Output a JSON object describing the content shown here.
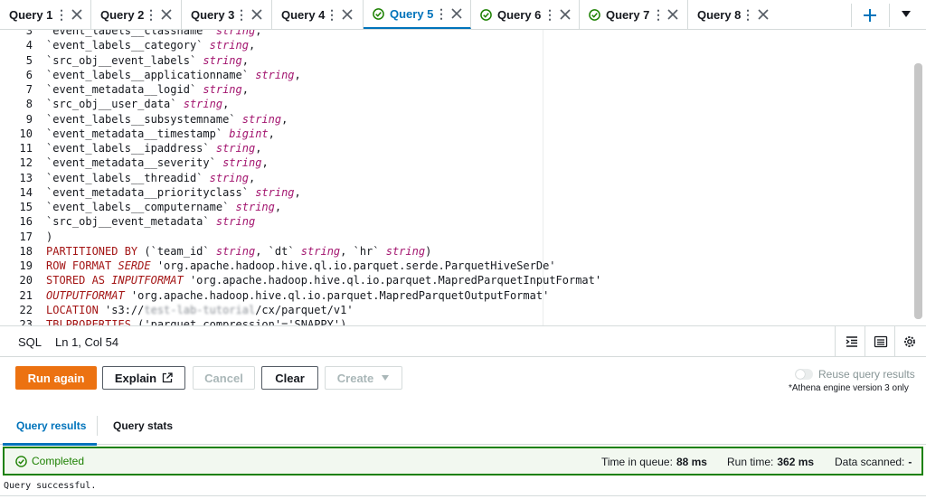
{
  "tabs": [
    {
      "label": "Query 1",
      "completed": false,
      "active": false
    },
    {
      "label": "Query 2",
      "completed": false,
      "active": false
    },
    {
      "label": "Query 3",
      "completed": false,
      "active": false
    },
    {
      "label": "Query 4",
      "completed": false,
      "active": false
    },
    {
      "label": "Query 5",
      "completed": true,
      "active": true
    },
    {
      "label": "Query 6",
      "completed": true,
      "active": false
    },
    {
      "label": "Query 7",
      "completed": true,
      "active": false
    },
    {
      "label": "Query 8",
      "completed": false,
      "active": false
    }
  ],
  "editor": {
    "lines": [
      {
        "n": "3",
        "parts": [
          [
            "plain",
            "`event_labels__classname` "
          ],
          [
            "typ",
            "string"
          ],
          [
            "plain",
            ","
          ]
        ]
      },
      {
        "n": "4",
        "parts": [
          [
            "plain",
            "`event_labels__category` "
          ],
          [
            "typ",
            "string"
          ],
          [
            "plain",
            ","
          ]
        ]
      },
      {
        "n": "5",
        "parts": [
          [
            "plain",
            "`src_obj__event_labels` "
          ],
          [
            "typ",
            "string"
          ],
          [
            "plain",
            ","
          ]
        ]
      },
      {
        "n": "6",
        "parts": [
          [
            "plain",
            "`event_labels__applicationname` "
          ],
          [
            "typ",
            "string"
          ],
          [
            "plain",
            ","
          ]
        ]
      },
      {
        "n": "7",
        "parts": [
          [
            "plain",
            "`event_metadata__logid` "
          ],
          [
            "typ",
            "string"
          ],
          [
            "plain",
            ","
          ]
        ]
      },
      {
        "n": "8",
        "parts": [
          [
            "plain",
            "`src_obj__user_data` "
          ],
          [
            "typ",
            "string"
          ],
          [
            "plain",
            ","
          ]
        ]
      },
      {
        "n": "9",
        "parts": [
          [
            "plain",
            "`event_labels__subsystemname` "
          ],
          [
            "typ",
            "string"
          ],
          [
            "plain",
            ","
          ]
        ]
      },
      {
        "n": "10",
        "parts": [
          [
            "plain",
            "`event_metadata__timestamp` "
          ],
          [
            "typ",
            "bigint"
          ],
          [
            "plain",
            ","
          ]
        ]
      },
      {
        "n": "11",
        "parts": [
          [
            "plain",
            "`event_labels__ipaddress` "
          ],
          [
            "typ",
            "string"
          ],
          [
            "plain",
            ","
          ]
        ]
      },
      {
        "n": "12",
        "parts": [
          [
            "plain",
            "`event_metadata__severity` "
          ],
          [
            "typ",
            "string"
          ],
          [
            "plain",
            ","
          ]
        ]
      },
      {
        "n": "13",
        "parts": [
          [
            "plain",
            "`event_labels__threadid` "
          ],
          [
            "typ",
            "string"
          ],
          [
            "plain",
            ","
          ]
        ]
      },
      {
        "n": "14",
        "parts": [
          [
            "plain",
            "`event_metadata__priorityclass` "
          ],
          [
            "typ",
            "string"
          ],
          [
            "plain",
            ","
          ]
        ]
      },
      {
        "n": "15",
        "parts": [
          [
            "plain",
            "`event_labels__computername` "
          ],
          [
            "typ",
            "string"
          ],
          [
            "plain",
            ","
          ]
        ]
      },
      {
        "n": "16",
        "parts": [
          [
            "plain",
            "`src_obj__event_metadata` "
          ],
          [
            "typ",
            "string"
          ]
        ]
      },
      {
        "n": "17",
        "parts": [
          [
            "plain",
            ")"
          ]
        ]
      },
      {
        "n": "18",
        "parts": [
          [
            "kw",
            "PARTITIONED BY"
          ],
          [
            "plain",
            " (`team_id` "
          ],
          [
            "typ",
            "string"
          ],
          [
            "plain",
            ", `dt` "
          ],
          [
            "typ",
            "string"
          ],
          [
            "plain",
            ", `hr` "
          ],
          [
            "typ",
            "string"
          ],
          [
            "plain",
            ")"
          ]
        ]
      },
      {
        "n": "19",
        "parts": [
          [
            "kw",
            "ROW FORMAT "
          ],
          [
            "kwi",
            "SERDE"
          ],
          [
            "plain",
            " 'org.apache.hadoop.hive.ql.io.parquet.serde.ParquetHiveSerDe'"
          ]
        ]
      },
      {
        "n": "20",
        "parts": [
          [
            "kw",
            "STORED AS "
          ],
          [
            "kwi",
            "INPUTFORMAT"
          ],
          [
            "plain",
            " 'org.apache.hadoop.hive.ql.io.parquet.MapredParquetInputFormat'"
          ]
        ]
      },
      {
        "n": "21",
        "parts": [
          [
            "kwi",
            "OUTPUTFORMAT"
          ],
          [
            "plain",
            " 'org.apache.hadoop.hive.ql.io.parquet.MapredParquetOutputFormat'"
          ]
        ]
      },
      {
        "n": "22",
        "parts": [
          [
            "kw",
            "LOCATION"
          ],
          [
            "plain",
            " 's3://"
          ],
          [
            "blur",
            "test-lab-tutorial"
          ],
          [
            "plain",
            "/cx/parquet/v1'"
          ]
        ]
      },
      {
        "n": "23",
        "parts": [
          [
            "kw",
            "TBLPROPERTIES"
          ],
          [
            "plain",
            " ('parquet.compression'='SNAPPY')"
          ]
        ]
      }
    ]
  },
  "status": {
    "language": "SQL",
    "position": "Ln 1, Col 54"
  },
  "actions": {
    "run_again": "Run again",
    "explain": "Explain",
    "cancel": "Cancel",
    "clear": "Clear",
    "create": "Create",
    "reuse_label": "Reuse query results",
    "engine_note": "*Athena engine version 3 only"
  },
  "results": {
    "tab_results": "Query results",
    "tab_stats": "Query stats",
    "status": "Completed",
    "queue_label": "Time in queue:",
    "queue_value": "88 ms",
    "run_label": "Run time:",
    "run_value": "362 ms",
    "scanned_label": "Data scanned:",
    "scanned_value": "-",
    "message": "Query successful."
  },
  "colors": {
    "accent": "#0073bb",
    "success": "#1d8102",
    "primary": "#ec7211"
  }
}
